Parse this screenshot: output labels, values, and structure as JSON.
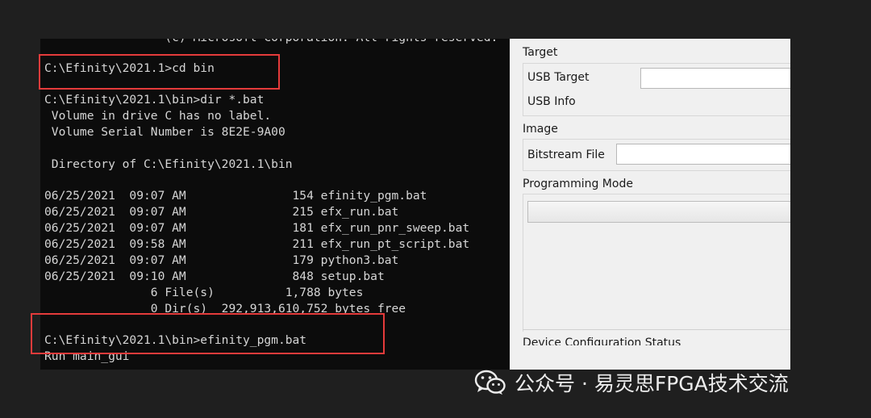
{
  "terminal": {
    "lines": [
      "                 (c) Microsoft Corporation. All rights reserved.",
      "C:\\Efinity\\2021.1>cd bin",
      "",
      "C:\\Efinity\\2021.1\\bin>dir *.bat",
      " Volume in drive C has no label.",
      " Volume Serial Number is 8E2E-9A00",
      "",
      " Directory of C:\\Efinity\\2021.1\\bin",
      "",
      "06/25/2021  09:07 AM               154 efinity_pgm.bat",
      "06/25/2021  09:07 AM               215 efx_run.bat",
      "06/25/2021  09:07 AM               181 efx_run_pnr_sweep.bat",
      "06/25/2021  09:58 AM               211 efx_run_pt_script.bat",
      "06/25/2021  09:07 AM               179 python3.bat",
      "06/25/2021  09:10 AM               848 setup.bat",
      "               6 File(s)          1,788 bytes",
      "               0 Dir(s)  292,913,610,752 bytes free",
      "",
      "C:\\Efinity\\2021.1\\bin>efinity_pgm.bat",
      "Run main_gui"
    ]
  },
  "programmer": {
    "target": {
      "heading": "Target",
      "usb_target_label": "USB Target",
      "usb_target_value": "",
      "usb_info_label": "USB Info"
    },
    "image": {
      "heading": "Image",
      "bitstream_label": "Bitstream File",
      "bitstream_value": ""
    },
    "programming_mode": {
      "heading": "Programming Mode",
      "selected": ""
    },
    "status": {
      "heading": "Device Configuration Status"
    }
  },
  "watermark": {
    "text": "公众号 · 易灵思FPGA技术交流",
    "icon": "wechat-icon"
  },
  "colors": {
    "terminal_bg": "#0c0c0c",
    "terminal_text": "#d6d6d6",
    "highlight": "#e53b3b",
    "panel_bg": "#f0f0f0"
  }
}
